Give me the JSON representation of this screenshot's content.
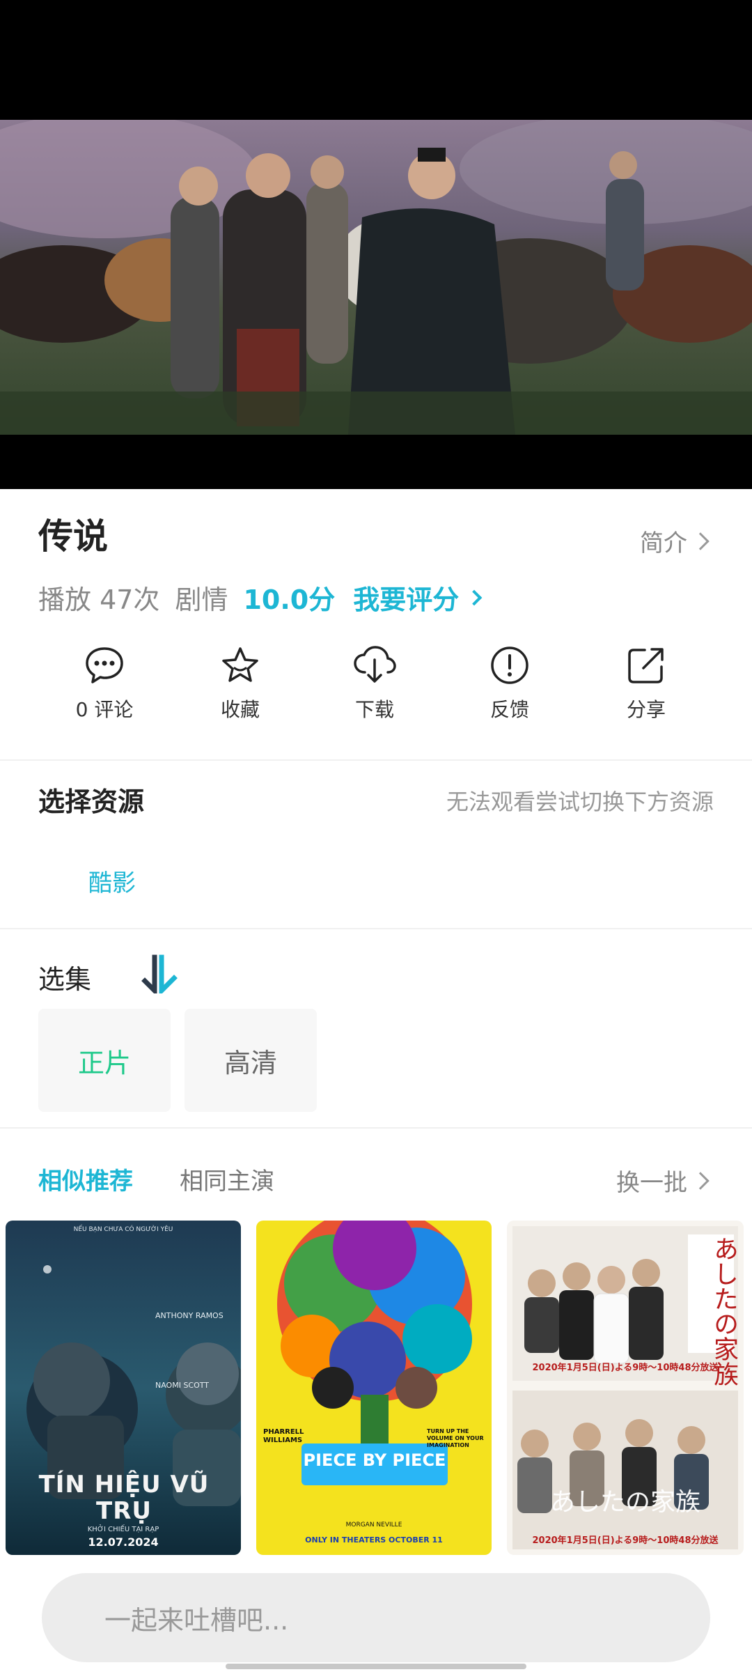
{
  "video": {
    "title": "传说",
    "intro_label": "简介"
  },
  "meta": {
    "plays": "播放 47次",
    "genre": "剧情",
    "score": "10.0分",
    "rate_label": "我要评分"
  },
  "actions": [
    {
      "icon": "comment-icon",
      "label": "0 评论"
    },
    {
      "icon": "star-icon",
      "label": "收藏"
    },
    {
      "icon": "cloud-download-icon",
      "label": "下载"
    },
    {
      "icon": "alert-icon",
      "label": "反馈"
    },
    {
      "icon": "share-icon",
      "label": "分享"
    }
  ],
  "source": {
    "title": "选择资源",
    "hint": "无法观看尝试切换下方资源",
    "selected": "酷影"
  },
  "episodes": {
    "title": "选集",
    "items": [
      "正片",
      "高清"
    ],
    "active_index": 0
  },
  "recommend": {
    "tabs": [
      "相似推荐",
      "相同主演"
    ],
    "active_tab": 0,
    "more_label": "换一批"
  },
  "posters": [
    {
      "title": "TÍN HIỆU VŨ TRỤ",
      "date": "12.07.2024",
      "top_text": "NẾU BẠN CHƯA CÓ NGƯỜI YÊU",
      "sub": "KHỞI CHIẾU TẠI RẠP",
      "names": [
        "ANTHONY RAMOS",
        "NAOMI SCOTT"
      ]
    },
    {
      "title": "PIECE BY PIECE",
      "names": [
        "PHARRELL WILLIAMS"
      ],
      "tag": "TURN UP THE VOLUME ON YOUR IMAGINATION",
      "director": "MORGAN NEVILLE",
      "release": "ONLY IN THEATERS OCTOBER 11"
    },
    {
      "title": "あしたの家族",
      "date_line": "2020年1月5日(日)よる9時～10時48分放送"
    }
  ],
  "comment": {
    "placeholder": "一起来吐槽吧..."
  },
  "colors": {
    "accent": "#1db6d4",
    "episode_active": "#1ec98a"
  }
}
